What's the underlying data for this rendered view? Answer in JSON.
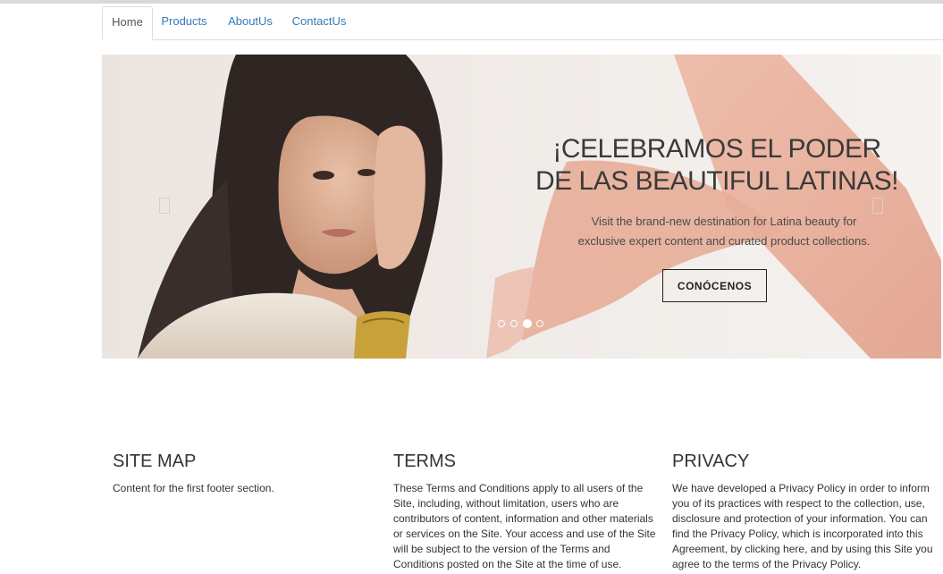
{
  "nav": {
    "tabs": [
      {
        "label": "Home",
        "active": true
      },
      {
        "label": "Products",
        "active": false
      },
      {
        "label": "AboutUs",
        "active": false
      },
      {
        "label": "ContactUs",
        "active": false
      }
    ]
  },
  "carousel": {
    "headline": [
      "¡CELEBRAMOS EL PODER",
      "DE LAS BEAUTIFUL LATINAS!"
    ],
    "subtext": [
      "Visit the brand-new destination for Latina beauty for",
      "exclusive expert content and curated product collections."
    ],
    "cta_label": "CONÓCENOS",
    "prev_icon": "chevron-left-icon",
    "next_icon": "chevron-right-icon",
    "slide_count": 4,
    "active_slide": 3,
    "colors": {
      "swatch": "#e9b09c",
      "background": "#f1ece8"
    }
  },
  "footer": {
    "sitemap": {
      "title": "SITE MAP",
      "lines": [
        "Content for the first footer section."
      ]
    },
    "terms": {
      "title": "TERMS",
      "lines": [
        "These Terms and Conditions apply to all users of the",
        "Site, including, without limitation, users who are",
        "contributors of content, information and other materials",
        "or services on the Site. Your access and use of the Site",
        "will be subject to the version of the Terms and",
        "Conditions posted on the Site at the time of use."
      ]
    },
    "privacy": {
      "title": "PRIVACY",
      "lines": [
        "We have developed a Privacy Policy in order to inform",
        "you of its practices with respect to the collection, use,",
        "disclosure and protection of your information. You can",
        "find the Privacy Policy, which is incorporated into this",
        "Agreement, by clicking here, and by using this Site you",
        "agree to the terms of the Privacy Policy."
      ]
    }
  }
}
